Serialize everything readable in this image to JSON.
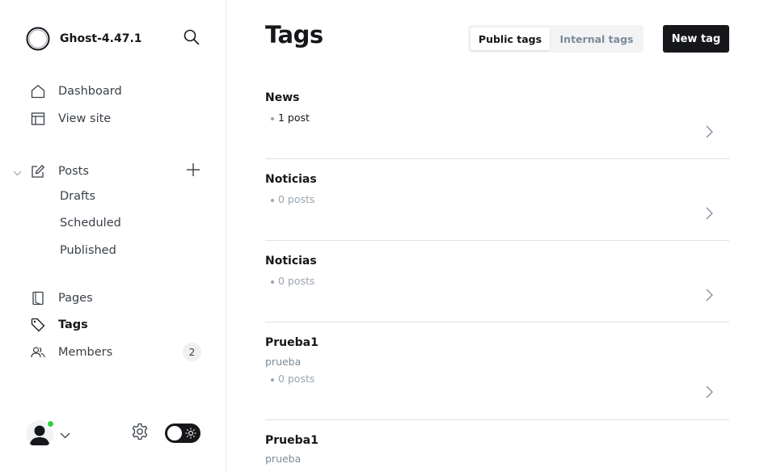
{
  "app": {
    "site_name": "Ghost-4.47.1"
  },
  "sidebar": {
    "nav": [
      {
        "id": "dashboard",
        "label": "Dashboard",
        "icon": "house-icon"
      },
      {
        "id": "view-site",
        "label": "View site",
        "icon": "layout-icon"
      }
    ],
    "posts": {
      "label": "Posts",
      "icon": "pencil-square-icon",
      "sub_items": [
        "Drafts",
        "Scheduled",
        "Published"
      ]
    },
    "lower_nav": [
      {
        "id": "pages",
        "label": "Pages",
        "icon": "page-icon"
      },
      {
        "id": "tags",
        "label": "Tags",
        "icon": "tag-icon",
        "active": true
      },
      {
        "id": "members",
        "label": "Members",
        "icon": "people-icon"
      }
    ],
    "members_count": "2"
  },
  "main": {
    "title": "Tags",
    "tabs": {
      "public": "Public tags",
      "internal": "Internal tags",
      "selected": "Public tags"
    },
    "new_tag_label": "New tag",
    "tags": [
      {
        "name": "News",
        "description": "",
        "count": "1 post"
      },
      {
        "name": "Noticias",
        "description": "",
        "count": "0 posts"
      },
      {
        "name": "Noticias",
        "description": "",
        "count": "0 posts"
      },
      {
        "name": "Prueba1",
        "description": "prueba",
        "count": "0 posts"
      },
      {
        "name": "Prueba1",
        "description": "prueba",
        "count": ""
      }
    ]
  },
  "colors": {
    "accent_dark": "#15171a",
    "online_green": "#30cf43",
    "muted_text": "#7c8b9a"
  }
}
